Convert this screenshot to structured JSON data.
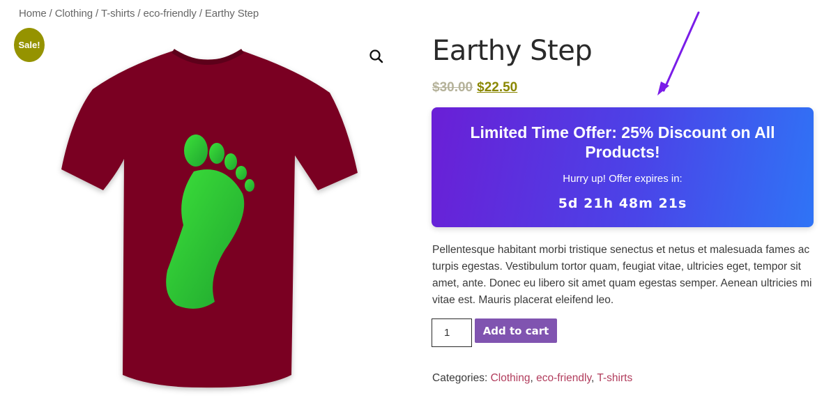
{
  "breadcrumb": {
    "items": [
      "Home",
      "Clothing",
      "T-shirts",
      "eco-friendly",
      "Earthy Step"
    ],
    "separator": "/"
  },
  "badge": {
    "label": "Sale!",
    "color": "#959300"
  },
  "product": {
    "title": "Earthy Step",
    "price_old": "$30.00",
    "price_new": "$22.50",
    "shirt_color": "#7a0024",
    "print_color": "#2fd12f"
  },
  "offer": {
    "title": "Limited Time Offer: 25% Discount on All Products!",
    "subtitle": "Hurry up! Offer expires in:",
    "countdown": "5d 21h 48m 21s"
  },
  "description": "Pellentesque habitant morbi tristique senectus et netus et malesuada fames ac turpis egestas. Vestibulum tortor quam, feugiat vitae, ultricies eget, tempor sit amet, ante. Donec eu libero sit amet quam egestas semper. Aenean ultricies mi vitae est. Mauris placerat eleifend leo.",
  "cart": {
    "quantity": "1",
    "add_label": "Add to cart"
  },
  "categories": {
    "label": "Categories:",
    "items": [
      "Clothing",
      "eco-friendly",
      "T-shirts"
    ]
  },
  "icons": {
    "zoom": "magnifier-icon",
    "annotation": "arrow-icon"
  },
  "annotation_color": "#7a1de8"
}
